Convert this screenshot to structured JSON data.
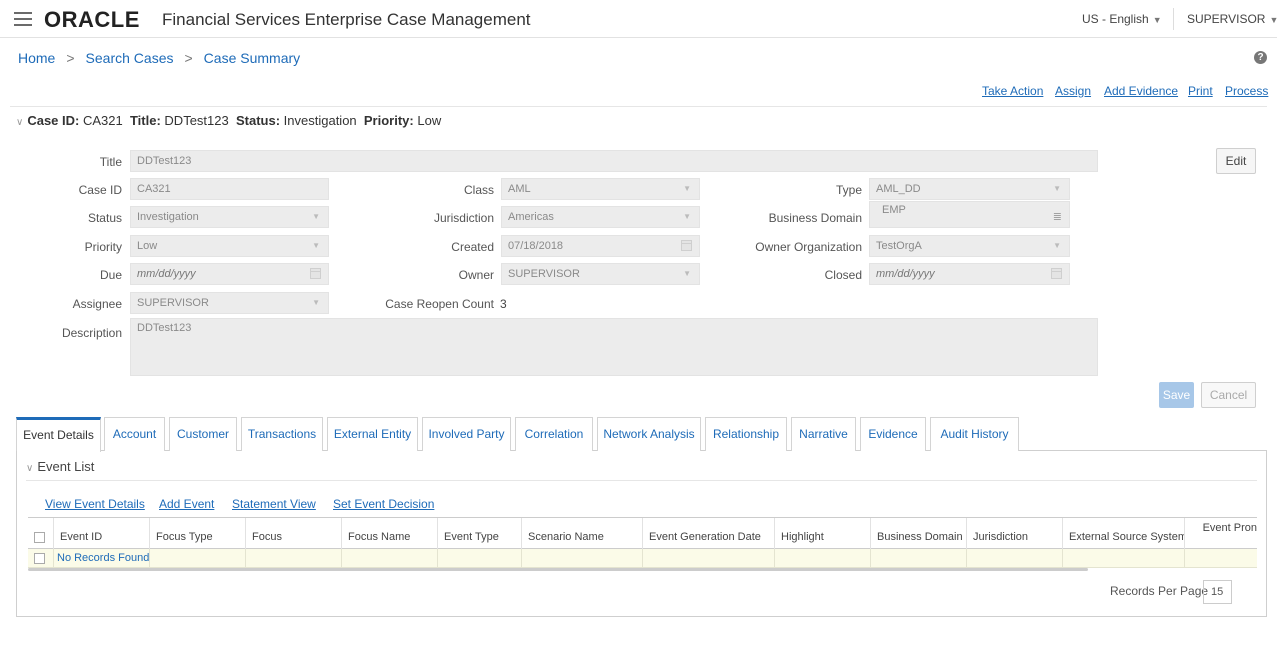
{
  "header": {
    "logo": "ORACLE",
    "app_title": "Financial Services Enterprise Case Management",
    "language": "US - English",
    "user": "SUPERVISOR"
  },
  "breadcrumb": {
    "home": "Home",
    "search_cases": "Search Cases",
    "case_summary": "Case Summary",
    "separator": ">"
  },
  "actions": {
    "take_action": "Take Action",
    "assign": "Assign",
    "add_evidence": "Add Evidence",
    "print": "Print",
    "process": "Process"
  },
  "case_header": {
    "case_id_label": "Case ID:",
    "case_id": "CA321",
    "title_label": "Title:",
    "title": "DDTest123",
    "status_label": "Status:",
    "status": "Investigation",
    "priority_label": "Priority:",
    "priority": "Low"
  },
  "form": {
    "title_label": "Title",
    "title_value": "DDTest123",
    "case_id_label": "Case ID",
    "case_id_value": "CA321",
    "class_label": "Class",
    "class_value": "AML",
    "type_label": "Type",
    "type_value": "AML_DD",
    "status_label": "Status",
    "status_value": "Investigation",
    "jurisdiction_label": "Jurisdiction",
    "jurisdiction_value": "Americas",
    "business_domain_label": "Business Domain",
    "business_domain_value": "EMP",
    "priority_label": "Priority",
    "priority_value": "Low",
    "created_label": "Created",
    "created_value": "07/18/2018",
    "owner_org_label": "Owner Organization",
    "owner_org_value": "TestOrgA",
    "due_label": "Due",
    "due_placeholder": "mm/dd/yyyy",
    "owner_label": "Owner",
    "owner_value": "SUPERVISOR",
    "closed_label": "Closed",
    "closed_placeholder": "mm/dd/yyyy",
    "assignee_label": "Assignee",
    "assignee_value": "SUPERVISOR",
    "reopen_label": "Case Reopen Count",
    "reopen_value": "3",
    "description_label": "Description",
    "description_value": "DDTest123",
    "edit_button": "Edit",
    "save_button": "Save",
    "cancel_button": "Cancel"
  },
  "tabs": [
    {
      "label": "Event Details"
    },
    {
      "label": "Account"
    },
    {
      "label": "Customer"
    },
    {
      "label": "Transactions"
    },
    {
      "label": "External Entity"
    },
    {
      "label": "Involved Party"
    },
    {
      "label": "Correlation"
    },
    {
      "label": "Network Analysis"
    },
    {
      "label": "Relationship"
    },
    {
      "label": "Narrative"
    },
    {
      "label": "Evidence"
    },
    {
      "label": "Audit History"
    }
  ],
  "event_list": {
    "title": "Event List",
    "links": {
      "view_event_details": "View Event Details",
      "add_event": "Add Event",
      "statement_view": "Statement View",
      "set_event_decision": "Set Event Decision"
    },
    "columns": [
      "Event ID",
      "Focus Type",
      "Focus",
      "Focus Name",
      "Event Type",
      "Scenario Name",
      "Event Generation Date",
      "Highlight",
      "Business Domain",
      "Jurisdiction",
      "External Source System",
      "Event Pron"
    ],
    "no_records": "No Records Found",
    "records_per_page_label": "Records Per Page",
    "records_per_page_value": "15"
  },
  "colors": {
    "link": "#1e6bb8",
    "field_bg": "#ececec",
    "save_bg": "#a7c7e8",
    "row_highlight": "#fbfbe8"
  }
}
